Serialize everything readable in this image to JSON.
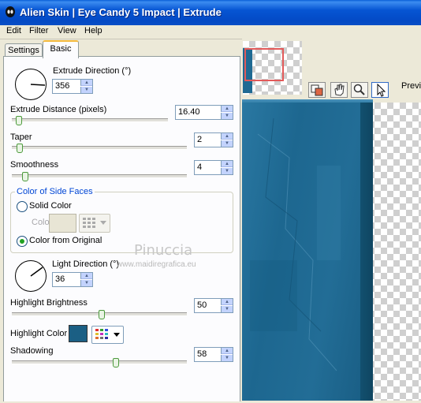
{
  "title": "Alien Skin | Eye Candy 5 Impact | Extrude",
  "menu": [
    "Edit",
    "Filter",
    "View",
    "Help"
  ],
  "tabs": {
    "settings": "Settings",
    "basic": "Basic"
  },
  "extrude_direction": {
    "label": "Extrude Direction (°)",
    "value": "356"
  },
  "extrude_distance": {
    "label": "Extrude Distance (pixels)",
    "value": "16.40"
  },
  "taper": {
    "label": "Taper",
    "value": "2"
  },
  "smoothness": {
    "label": "Smoothness",
    "value": "4"
  },
  "side_faces": {
    "group_label": "Color of Side Faces",
    "solid_color": "Solid Color",
    "color_label": "Color",
    "from_original": "Color from Original",
    "selected": "from_original"
  },
  "light_direction": {
    "label": "Light Direction (°)",
    "value": "36"
  },
  "highlight_brightness": {
    "label": "Highlight Brightness",
    "value": "50"
  },
  "highlight_color": {
    "label": "Highlight Color",
    "swatch": "#1b5f84"
  },
  "shadowing": {
    "label": "Shadowing",
    "value": "58"
  },
  "preview": {
    "label": "Previ"
  },
  "watermark": {
    "name": "Pinuccia",
    "site": "www.maidiregrafica.eu"
  },
  "colors": {
    "titlebar": "#0553d2",
    "accent": "#0046d5",
    "preview_blue": "#1d6790"
  }
}
